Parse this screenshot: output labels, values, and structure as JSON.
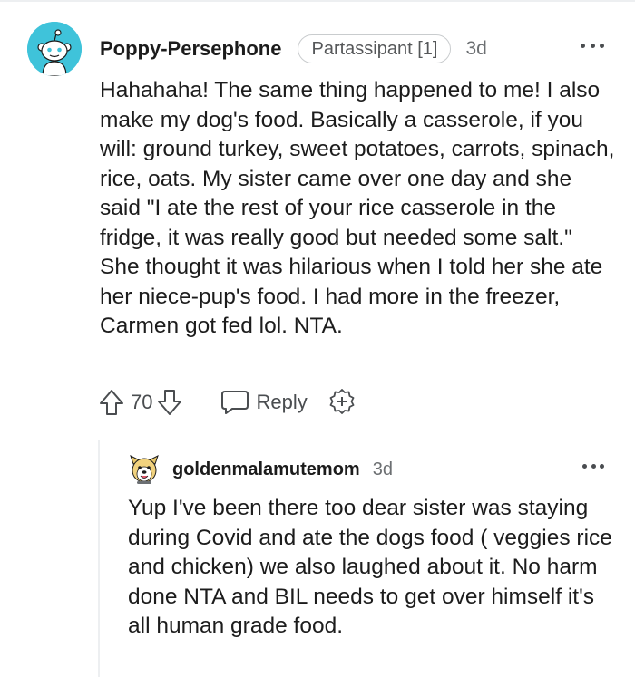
{
  "comment": {
    "username": "Poppy-Persephone",
    "flair": "Partassipant [1]",
    "time": "3d",
    "body": "Hahahaha! The same thing happened to me! I also make my dog's food. Basically a casserole, if you will: ground turkey, sweet potatoes, carrots, spinach, rice, oats. My sister came over one day and she said \"I ate the rest of your rice casserole in the fridge, it was really good but needed some salt.\" She thought it was hilarious when I told her she ate her niece-pup's food. I had more in the freezer, Carmen got fed lol. NTA.",
    "votes": "70",
    "reply_label": "Reply",
    "avatar_color": "#3fc3da"
  },
  "reply": {
    "username": "goldenmalamutemom",
    "time": "3d",
    "body": "Yup I've been there too dear sister was staying during Covid and ate the dogs food ( veggies rice and chicken) we also laughed about it. No harm done NTA and BIL needs to get over himself it's all human grade food."
  },
  "icons": {
    "upvote": "arrow-up-icon",
    "downvote": "arrow-down-icon",
    "reply": "speech-bubble-icon",
    "award": "award-plus-icon",
    "more": "more-horizontal-icon"
  }
}
